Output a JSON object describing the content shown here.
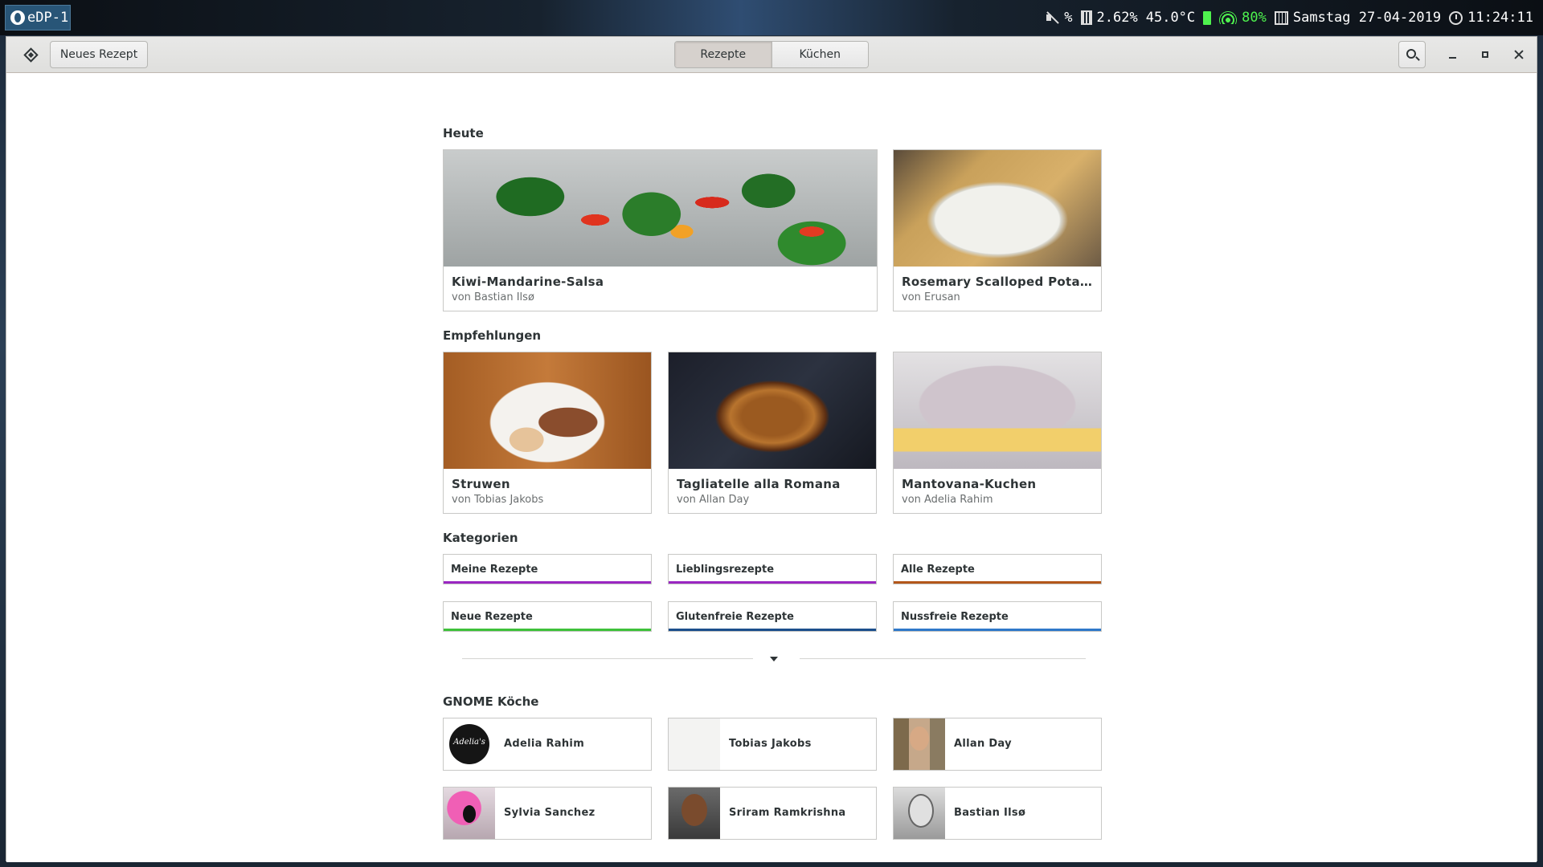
{
  "system_bar": {
    "workspace": "eDP-1",
    "volume": "%",
    "memory": "2.62%",
    "temperature": "45.0°C",
    "wifi": "80%",
    "date": "Samstag 27-04-2019",
    "time": "11:24:11"
  },
  "headerbar": {
    "new_recipe": "Neues Rezept",
    "tabs": [
      {
        "label": "Rezepte",
        "active": true
      },
      {
        "label": "Küchen",
        "active": false
      }
    ]
  },
  "sections": {
    "today": "Heute",
    "recommendations": "Empfehlungen",
    "categories": "Kategorien",
    "chefs": "GNOME Köche"
  },
  "today": [
    {
      "title": "Kiwi-Mandarine-Salsa",
      "author": "von Bastian Ilsø"
    },
    {
      "title": "Rosemary Scalloped Potat…",
      "author": "von Erusan"
    }
  ],
  "recommendations": [
    {
      "title": "Struwen",
      "author": "von Tobias Jakobs"
    },
    {
      "title": "Tagliatelle alla Romana",
      "author": "von Allan Day"
    },
    {
      "title": "Mantovana-Kuchen",
      "author": "von Adelia Rahim"
    }
  ],
  "categories": [
    {
      "label": "Meine Rezepte",
      "color": "#9a27c2"
    },
    {
      "label": "Lieblingsrezepte",
      "color": "#9a27c2"
    },
    {
      "label": "Alle Rezepte",
      "color": "#b3571a"
    },
    {
      "label": "Neue Rezepte",
      "color": "#3ec13a"
    },
    {
      "label": "Glutenfreie Rezepte",
      "color": "#1c4f8c"
    },
    {
      "label": "Nussfreie Rezepte",
      "color": "#2f78c9"
    }
  ],
  "chefs": [
    {
      "name": "Adelia Rahim",
      "avatar_text": "Adelia's"
    },
    {
      "name": "Tobias Jakobs"
    },
    {
      "name": "Allan Day"
    },
    {
      "name": "Sylvia Sanchez"
    },
    {
      "name": "Sriram Ramkrishna"
    },
    {
      "name": "Bastian Ilsø"
    }
  ]
}
